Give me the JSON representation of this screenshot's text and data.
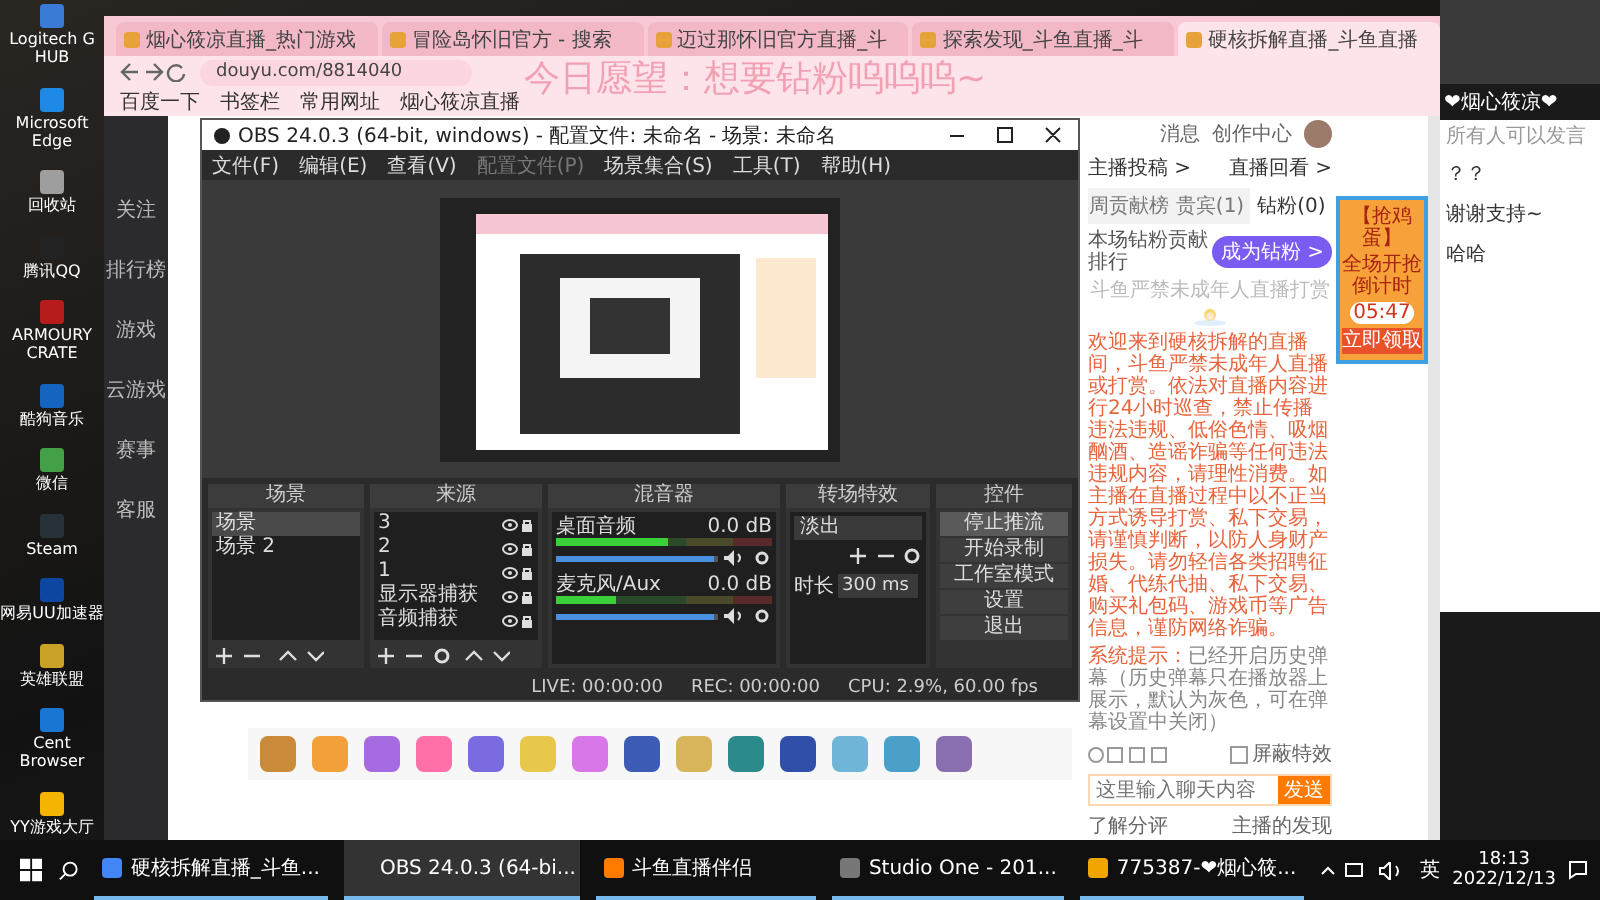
{
  "desktop_icons": [
    {
      "label": "Logitech G HUB"
    },
    {
      "label": "Microsoft Edge"
    },
    {
      "label": "回收站"
    },
    {
      "label": "腾讯QQ"
    },
    {
      "label": "ARMOURY CRATE"
    },
    {
      "label": "酷狗音乐"
    },
    {
      "label": "微信"
    },
    {
      "label": "Steam"
    },
    {
      "label": "网易UU加速器"
    },
    {
      "label": "英雄联盟"
    },
    {
      "label": "Cent Browser"
    },
    {
      "label": "YY游戏大厅"
    }
  ],
  "browser": {
    "tabs": [
      {
        "title": "烟心筱凉直播_热门游戏",
        "selected": false
      },
      {
        "title": "冒险岛怀旧官方 - 搜索",
        "selected": false
      },
      {
        "title": "迈过那怀旧官方直播_斗",
        "selected": false
      },
      {
        "title": "探索发现_斗鱼直播_斗",
        "selected": false
      },
      {
        "title": "硬核拆解直播_斗鱼直播",
        "selected": true
      }
    ],
    "url": "douyu.com/8814040",
    "bookmarks": [
      {
        "label": "百度一下"
      },
      {
        "label": "书签栏"
      },
      {
        "label": "常用网址"
      },
      {
        "label": "烟心筱凉直播"
      }
    ],
    "overlay_banner": "今日愿望：想要钻粉呜呜呜~",
    "site_sidebar": [
      {
        "label": "关注"
      },
      {
        "label": "排行榜"
      },
      {
        "label": "游戏"
      },
      {
        "label": "云游戏"
      },
      {
        "label": "赛事"
      },
      {
        "label": "客服"
      }
    ],
    "header_links": [
      {
        "label": "消息"
      },
      {
        "label": "创作中心"
      }
    ],
    "room_links": [
      "主播投稿 >",
      "直播回看 >"
    ],
    "rank_tabs": [
      {
        "label": "周贡献榜",
        "selected": false
      },
      {
        "label": "贵宾(1)",
        "selected": false
      },
      {
        "label": "钻粉(0)",
        "selected": true
      }
    ],
    "rank_title": "本场钻粉贡献排行",
    "become_fan_button": "成为钻粉 >",
    "rank_empty": "斗鱼严禁未成年人直播打赏",
    "notice": "欢迎来到硬核拆解的直播间，斗鱼严禁未成年人直播或打赏。依法对直播内容进行24小时巡查，禁止传播违法违规、低俗色情、吸烟酗酒、造谣诈骗等任何违法违规内容，请理性消费。如主播在直播过程中以不正当方式诱导打赏、私下交易，请谨慎判断，以防人身财产损失。请勿轻信各类招聘征婚、代练代抽、私下交易、购买礼包码、游戏币等广告信息，谨防网络诈骗。",
    "system_tip": {
      "label": "系统提示：",
      "text": "已经开启历史弹幕（历史弹幕只在播放器上展示，默认为灰色，可在弹幕设置中关闭）"
    },
    "block_effects": {
      "label": "屏蔽特效",
      "checked": false
    },
    "chat_input": {
      "placeholder": "这里输入聊天内容"
    },
    "send_button": "发送",
    "footer_tabs": [
      "了解分评",
      "主播的发现"
    ],
    "ad": {
      "title": "【抢鸡蛋】",
      "subtitle": "全场开抢倒计时",
      "countdown": "05:47",
      "button": "立即领取"
    }
  },
  "obs": {
    "title": "OBS 24.0.3 (64-bit, windows) - 配置文件: 未命名 - 场景: 未命名",
    "menu": [
      {
        "label": "文件(F)",
        "disabled": false
      },
      {
        "label": "编辑(E)",
        "disabled": false
      },
      {
        "label": "查看(V)",
        "disabled": false
      },
      {
        "label": "配置文件(P)",
        "disabled": true
      },
      {
        "label": "场景集合(S)",
        "disabled": false
      },
      {
        "label": "工具(T)",
        "disabled": false
      },
      {
        "label": "帮助(H)",
        "disabled": false
      }
    ],
    "docks": {
      "scenes": "场景",
      "sources": "来源",
      "mixer": "混音器",
      "transitions": "转场特效",
      "controls": "控件"
    },
    "scenes": [
      {
        "name": "场景",
        "selected": true
      },
      {
        "name": "场景 2",
        "selected": false
      }
    ],
    "sources": [
      {
        "name": "3"
      },
      {
        "name": "2"
      },
      {
        "name": "1"
      },
      {
        "name": "显示器捕获"
      },
      {
        "name": "音频捕获"
      }
    ],
    "mixer": [
      {
        "name": "桌面音频",
        "reading": "0.0 dB",
        "meter": {
          "level": 0.52
        },
        "fader": {
          "level": 0.98
        }
      },
      {
        "name": "麦克风/Aux",
        "reading": "0.0 dB",
        "meter": {
          "level": 0.28
        },
        "fader": {
          "level": 0.98
        }
      }
    ],
    "transition": {
      "value": "淡出",
      "duration_label": "时长",
      "duration": "300 ms"
    },
    "controls": [
      {
        "label": "停止推流",
        "pressed": true
      },
      {
        "label": "开始录制",
        "pressed": false
      },
      {
        "label": "工作室模式",
        "pressed": false
      },
      {
        "label": "设置",
        "pressed": false
      },
      {
        "label": "退出",
        "pressed": false
      }
    ],
    "status": [
      "LIVE: 00:00:00",
      "REC: 00:00:00",
      "CPU: 2.9%, 60.00 fps"
    ]
  },
  "stream_chat": {
    "streamer": "❤烟心筱凉❤",
    "permission": "所有人可以发言",
    "messages": [
      "？？",
      "谢谢支持~",
      "哈哈"
    ]
  },
  "taskbar": {
    "apps": [
      {
        "label": "硬核拆解直播_斗鱼...",
        "selected": false
      },
      {
        "label": "OBS 24.0.3 (64-bi...",
        "selected": true
      },
      {
        "label": "斗鱼直播伴侣",
        "selected": false
      },
      {
        "label": "Studio One - 201...",
        "selected": false
      },
      {
        "label": "775387-❤烟心筱...",
        "selected": false
      }
    ],
    "ime": "英",
    "time": "18:13",
    "date": "2022/12/13"
  }
}
